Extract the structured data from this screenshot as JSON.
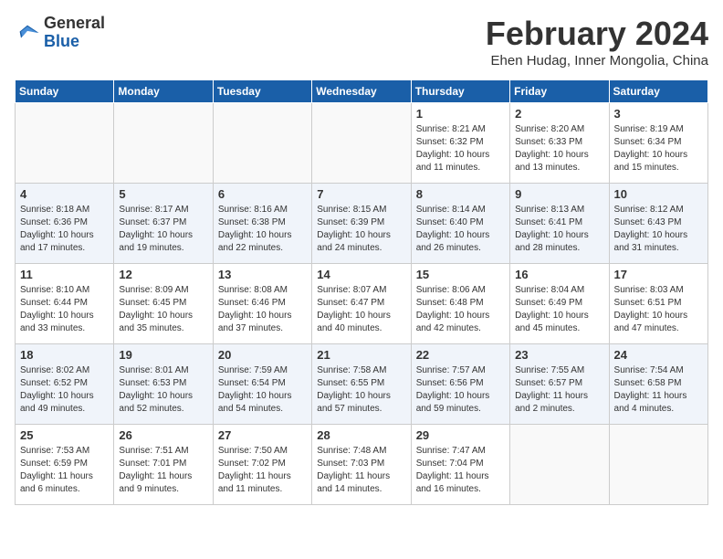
{
  "header": {
    "logo_line1": "General",
    "logo_line2": "Blue",
    "month_title": "February 2024",
    "subtitle": "Ehen Hudag, Inner Mongolia, China"
  },
  "weekdays": [
    "Sunday",
    "Monday",
    "Tuesday",
    "Wednesday",
    "Thursday",
    "Friday",
    "Saturday"
  ],
  "weeks": [
    [
      {
        "day": "",
        "info": ""
      },
      {
        "day": "",
        "info": ""
      },
      {
        "day": "",
        "info": ""
      },
      {
        "day": "",
        "info": ""
      },
      {
        "day": "1",
        "info": "Sunrise: 8:21 AM\nSunset: 6:32 PM\nDaylight: 10 hours\nand 11 minutes."
      },
      {
        "day": "2",
        "info": "Sunrise: 8:20 AM\nSunset: 6:33 PM\nDaylight: 10 hours\nand 13 minutes."
      },
      {
        "day": "3",
        "info": "Sunrise: 8:19 AM\nSunset: 6:34 PM\nDaylight: 10 hours\nand 15 minutes."
      }
    ],
    [
      {
        "day": "4",
        "info": "Sunrise: 8:18 AM\nSunset: 6:36 PM\nDaylight: 10 hours\nand 17 minutes."
      },
      {
        "day": "5",
        "info": "Sunrise: 8:17 AM\nSunset: 6:37 PM\nDaylight: 10 hours\nand 19 minutes."
      },
      {
        "day": "6",
        "info": "Sunrise: 8:16 AM\nSunset: 6:38 PM\nDaylight: 10 hours\nand 22 minutes."
      },
      {
        "day": "7",
        "info": "Sunrise: 8:15 AM\nSunset: 6:39 PM\nDaylight: 10 hours\nand 24 minutes."
      },
      {
        "day": "8",
        "info": "Sunrise: 8:14 AM\nSunset: 6:40 PM\nDaylight: 10 hours\nand 26 minutes."
      },
      {
        "day": "9",
        "info": "Sunrise: 8:13 AM\nSunset: 6:41 PM\nDaylight: 10 hours\nand 28 minutes."
      },
      {
        "day": "10",
        "info": "Sunrise: 8:12 AM\nSunset: 6:43 PM\nDaylight: 10 hours\nand 31 minutes."
      }
    ],
    [
      {
        "day": "11",
        "info": "Sunrise: 8:10 AM\nSunset: 6:44 PM\nDaylight: 10 hours\nand 33 minutes."
      },
      {
        "day": "12",
        "info": "Sunrise: 8:09 AM\nSunset: 6:45 PM\nDaylight: 10 hours\nand 35 minutes."
      },
      {
        "day": "13",
        "info": "Sunrise: 8:08 AM\nSunset: 6:46 PM\nDaylight: 10 hours\nand 37 minutes."
      },
      {
        "day": "14",
        "info": "Sunrise: 8:07 AM\nSunset: 6:47 PM\nDaylight: 10 hours\nand 40 minutes."
      },
      {
        "day": "15",
        "info": "Sunrise: 8:06 AM\nSunset: 6:48 PM\nDaylight: 10 hours\nand 42 minutes."
      },
      {
        "day": "16",
        "info": "Sunrise: 8:04 AM\nSunset: 6:49 PM\nDaylight: 10 hours\nand 45 minutes."
      },
      {
        "day": "17",
        "info": "Sunrise: 8:03 AM\nSunset: 6:51 PM\nDaylight: 10 hours\nand 47 minutes."
      }
    ],
    [
      {
        "day": "18",
        "info": "Sunrise: 8:02 AM\nSunset: 6:52 PM\nDaylight: 10 hours\nand 49 minutes."
      },
      {
        "day": "19",
        "info": "Sunrise: 8:01 AM\nSunset: 6:53 PM\nDaylight: 10 hours\nand 52 minutes."
      },
      {
        "day": "20",
        "info": "Sunrise: 7:59 AM\nSunset: 6:54 PM\nDaylight: 10 hours\nand 54 minutes."
      },
      {
        "day": "21",
        "info": "Sunrise: 7:58 AM\nSunset: 6:55 PM\nDaylight: 10 hours\nand 57 minutes."
      },
      {
        "day": "22",
        "info": "Sunrise: 7:57 AM\nSunset: 6:56 PM\nDaylight: 10 hours\nand 59 minutes."
      },
      {
        "day": "23",
        "info": "Sunrise: 7:55 AM\nSunset: 6:57 PM\nDaylight: 11 hours\nand 2 minutes."
      },
      {
        "day": "24",
        "info": "Sunrise: 7:54 AM\nSunset: 6:58 PM\nDaylight: 11 hours\nand 4 minutes."
      }
    ],
    [
      {
        "day": "25",
        "info": "Sunrise: 7:53 AM\nSunset: 6:59 PM\nDaylight: 11 hours\nand 6 minutes."
      },
      {
        "day": "26",
        "info": "Sunrise: 7:51 AM\nSunset: 7:01 PM\nDaylight: 11 hours\nand 9 minutes."
      },
      {
        "day": "27",
        "info": "Sunrise: 7:50 AM\nSunset: 7:02 PM\nDaylight: 11 hours\nand 11 minutes."
      },
      {
        "day": "28",
        "info": "Sunrise: 7:48 AM\nSunset: 7:03 PM\nDaylight: 11 hours\nand 14 minutes."
      },
      {
        "day": "29",
        "info": "Sunrise: 7:47 AM\nSunset: 7:04 PM\nDaylight: 11 hours\nand 16 minutes."
      },
      {
        "day": "",
        "info": ""
      },
      {
        "day": "",
        "info": ""
      }
    ]
  ]
}
